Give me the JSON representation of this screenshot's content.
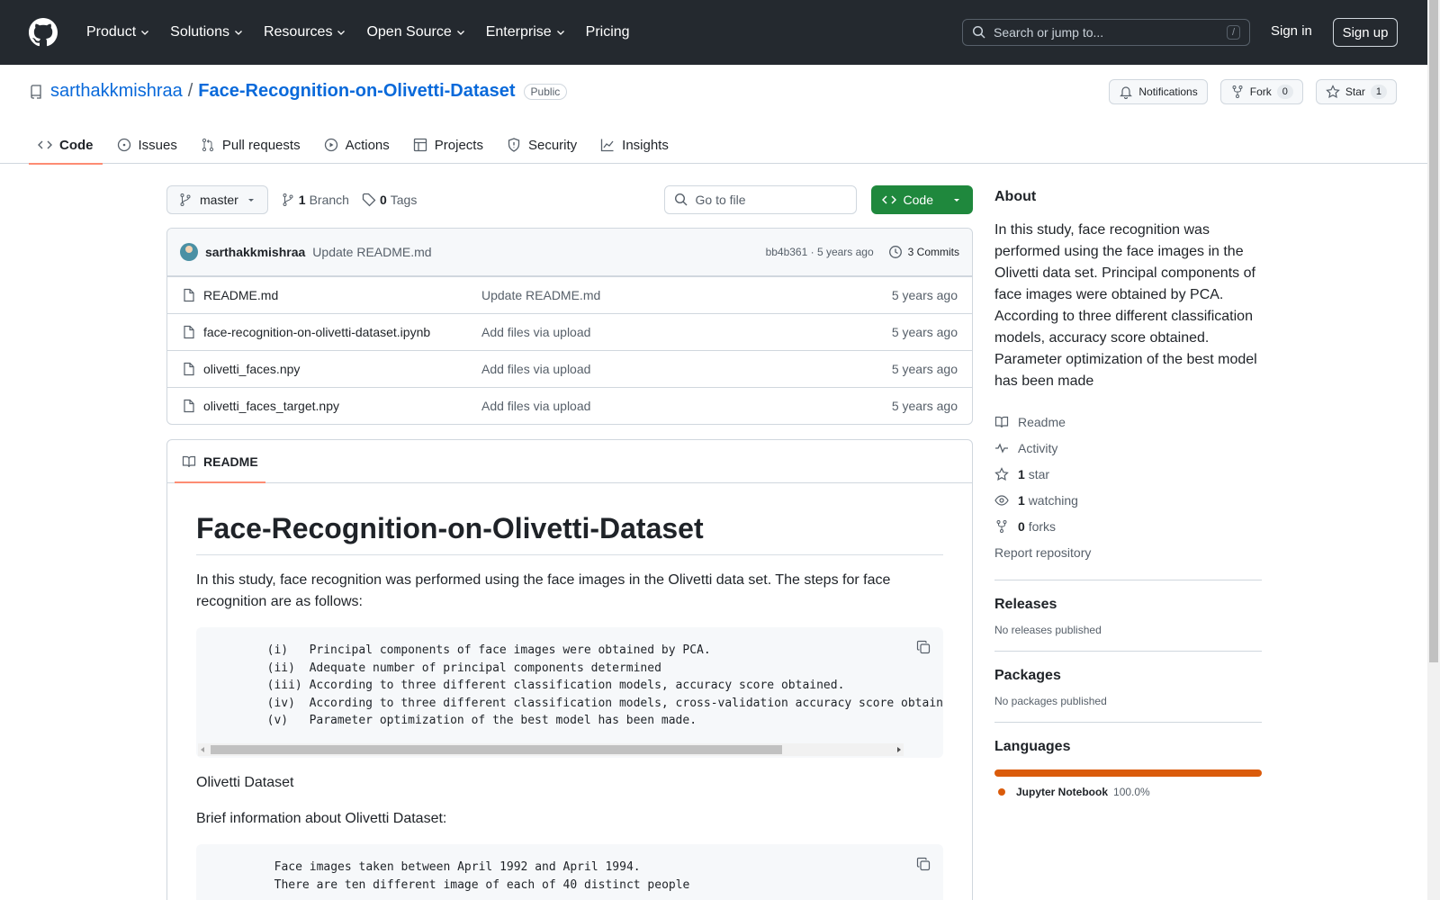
{
  "header": {
    "nav": [
      {
        "label": "Product",
        "dropdown": true
      },
      {
        "label": "Solutions",
        "dropdown": true
      },
      {
        "label": "Resources",
        "dropdown": true
      },
      {
        "label": "Open Source",
        "dropdown": true
      },
      {
        "label": "Enterprise",
        "dropdown": true
      },
      {
        "label": "Pricing",
        "dropdown": false
      }
    ],
    "search_placeholder": "Search or jump to...",
    "search_shortcut": "/",
    "sign_in": "Sign in",
    "sign_up": "Sign up"
  },
  "repo": {
    "owner": "sarthakkmishraa",
    "separator": "/",
    "name": "Face-Recognition-on-Olivetti-Dataset",
    "visibility": "Public",
    "notifications": "Notifications",
    "fork_label": "Fork",
    "fork_count": "0",
    "star_label": "Star",
    "star_count": "1",
    "tabs": [
      "Code",
      "Issues",
      "Pull requests",
      "Actions",
      "Projects",
      "Security",
      "Insights"
    ]
  },
  "toolbar": {
    "branch": "master",
    "branch_count": "1",
    "branch_label": "Branch",
    "tag_count": "0",
    "tag_label": "Tags",
    "goto_placeholder": "Go to file",
    "code_button": "Code"
  },
  "latest_commit": {
    "author": "sarthakkmishraa",
    "message": "Update README.md",
    "meta": "bb4b361 · 5 years ago",
    "commits": "3 Commits"
  },
  "files": [
    {
      "name": "README.md",
      "message": "Update README.md",
      "age": "5 years ago"
    },
    {
      "name": "face-recognition-on-olivetti-dataset.ipynb",
      "message": "Add files via upload",
      "age": "5 years ago"
    },
    {
      "name": "olivetti_faces.npy",
      "message": "Add files via upload",
      "age": "5 years ago"
    },
    {
      "name": "olivetti_faces_target.npy",
      "message": "Add files via upload",
      "age": "5 years ago"
    }
  ],
  "readme": {
    "tab": "README",
    "title": "Face-Recognition-on-Olivetti-Dataset",
    "intro": "In this study, face recognition was performed using the face images in the Olivetti data set. The steps for face recognition are as follows:",
    "steps_code": "        (i)   Principal components of face images were obtained by PCA.\n        (ii)  Adequate number of principal components determined\n        (iii) According to three different classification models, accuracy score obtained.\n        (iv)  According to three different classification models, cross-validation accuracy score obtained.\n        (v)   Parameter optimization of the best model has been made.",
    "dataset_heading": "Olivetti Dataset",
    "brief": "Brief information about Olivetti Dataset:",
    "dataset_code": "        Face images taken between April 1992 and April 1994.\n        There are ten different image of each of 40 distinct people"
  },
  "about": {
    "heading": "About",
    "description": "In this study, face recognition was performed using the face images in the Olivetti data set. Principal components of face images were obtained by PCA. According to three different classification models, accuracy score obtained. Parameter optimization of the best model has been made",
    "readme": "Readme",
    "activity": "Activity",
    "stars_count": "1",
    "stars_label": "star",
    "watching_count": "1",
    "watching_label": "watching",
    "forks_count": "0",
    "forks_label": "forks",
    "report": "Report repository"
  },
  "releases": {
    "heading": "Releases",
    "empty": "No releases published"
  },
  "packages": {
    "heading": "Packages",
    "empty": "No packages published"
  },
  "languages": {
    "heading": "Languages",
    "items": [
      {
        "name": "Jupyter Notebook",
        "percent": "100.0%",
        "color": "#da5b0b"
      }
    ]
  },
  "colors": {
    "header_bg": "#24292f",
    "link": "#0969da",
    "primary_button": "#1f883d",
    "active_tab_underline": "#fd8c73"
  }
}
